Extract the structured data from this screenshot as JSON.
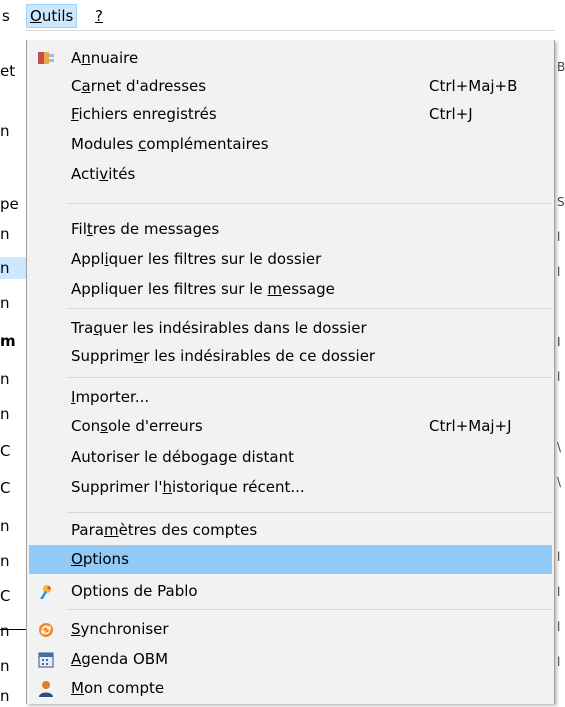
{
  "menubar": {
    "prev_fragment": "s",
    "outils_first": "O",
    "outils_rest": "utils",
    "help_label": "?"
  },
  "background": {
    "left_fragments": [
      "et",
      "n",
      "pe",
      "n",
      "n",
      "n",
      "m",
      "n",
      "n",
      "C",
      "C",
      "n",
      "n",
      "C",
      "n",
      "n",
      "n"
    ],
    "right_fragments": [
      "B",
      "S",
      "l",
      "l",
      "I",
      "l",
      "\\",
      "\\",
      "l",
      "l",
      "l",
      "l"
    ]
  },
  "menu": {
    "items": [
      {
        "id": "annuaire",
        "pre": "",
        "mn": "n",
        "post": "nuaire",
        "first": "A",
        "shortcut": "",
        "icon": "annuaire"
      },
      {
        "id": "carnet",
        "pre": "C",
        "mn": "a",
        "post": "rnet d'adresses",
        "shortcut": "Ctrl+Maj+B"
      },
      {
        "id": "fichiers",
        "pre": "",
        "mn": "F",
        "post": "ichiers enregistrés",
        "shortcut": "Ctrl+J"
      },
      {
        "id": "modules",
        "pre": "Modules ",
        "mn": "c",
        "post": "omplémentaires",
        "shortcut": ""
      },
      {
        "id": "activites",
        "pre": "Acti",
        "mn": "v",
        "post": "ités",
        "shortcut": ""
      },
      {
        "id": "filtres",
        "pre": "Fil",
        "mn": "t",
        "post": "res de messages",
        "shortcut": ""
      },
      {
        "id": "appliquer-dossier",
        "pre": "Appl",
        "mn": "i",
        "post": "quer les filtres sur le dossier",
        "shortcut": ""
      },
      {
        "id": "appliquer-message",
        "pre": "Appliquer les filtres sur le ",
        "mn": "m",
        "post": "essage",
        "shortcut": ""
      },
      {
        "id": "traquer",
        "pre": "Tra",
        "mn": "q",
        "post": "uer les indésirables dans le dossier",
        "shortcut": ""
      },
      {
        "id": "supprimer-indesirables",
        "pre": "Supprim",
        "mn": "e",
        "post": "r les indésirables de ce dossier",
        "shortcut": ""
      },
      {
        "id": "importer",
        "pre": "",
        "mn": "I",
        "post": "mporter...",
        "shortcut": ""
      },
      {
        "id": "console",
        "pre": "Con",
        "mn": "s",
        "post": "ole d'erreurs",
        "shortcut": "Ctrl+Maj+J"
      },
      {
        "id": "debogage",
        "pre": "Autoriser le débo",
        "mn": "g",
        "post": "age distant",
        "shortcut": ""
      },
      {
        "id": "historique",
        "pre": "Supprimer l'",
        "mn": "h",
        "post": "istorique récent...",
        "shortcut": ""
      },
      {
        "id": "parametres",
        "pre": "Para",
        "mn": "m",
        "post": "ètres des comptes",
        "shortcut": ""
      },
      {
        "id": "options",
        "pre": "",
        "mn": "O",
        "post": "ptions",
        "shortcut": "",
        "highlighted": true
      },
      {
        "id": "options-pablo",
        "pre": "Options de Pablo",
        "mn": "",
        "post": "",
        "shortcut": "",
        "icon": "pablo"
      },
      {
        "id": "synchroniser",
        "pre": "",
        "mn": "S",
        "post": "ynchroniser",
        "shortcut": "",
        "icon": "sync"
      },
      {
        "id": "agenda",
        "pre": "",
        "mn": "A",
        "post": "genda OBM",
        "shortcut": "",
        "icon": "agenda"
      },
      {
        "id": "mon-compte",
        "pre": "",
        "mn": "M",
        "post": "on compte",
        "shortcut": "",
        "icon": "account"
      }
    ]
  },
  "colors": {
    "menu_bg": "#f2f2f2",
    "highlight": "#91c9f7",
    "menubar_active": "#cce8ff",
    "separator": "#d7d7d7"
  }
}
